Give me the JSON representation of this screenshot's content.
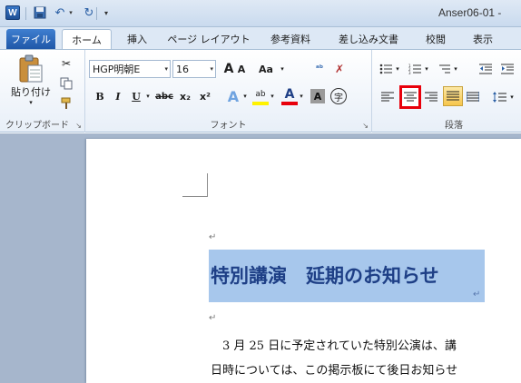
{
  "title_bar": {
    "doc_title": "Anser06-01  -",
    "app_icon_letter": "W"
  },
  "tabs": {
    "file": "ファイル",
    "items": [
      "ホーム",
      "挿入",
      "ページ レイアウト",
      "参考資料",
      "差し込み文書",
      "校閲",
      "表示"
    ]
  },
  "ribbon": {
    "clipboard": {
      "label": "クリップボード",
      "paste_label": "貼り付け"
    },
    "font": {
      "label": "フォント",
      "font_name": "HGP明朝E",
      "font_size": "16",
      "grow": "A",
      "shrink": "A",
      "case": "Aa",
      "bold": "B",
      "italic": "I",
      "underline": "U",
      "strike": "abc",
      "subscript": "x₂",
      "superscript": "x²",
      "effects": "A",
      "highlight": "ab",
      "font_color": "A",
      "char_shading": "A",
      "enclose": "字"
    },
    "paragraph": {
      "label": "段落"
    },
    "highlight_box_color": "#e8000b"
  },
  "document": {
    "headline": "特別講演　延期のお知らせ",
    "line1": "　3 月 25 日に予定されていた特別公演は、講",
    "line2": "日時については、この掲示板にて後日お知らせ",
    "para_mark": "↵"
  }
}
